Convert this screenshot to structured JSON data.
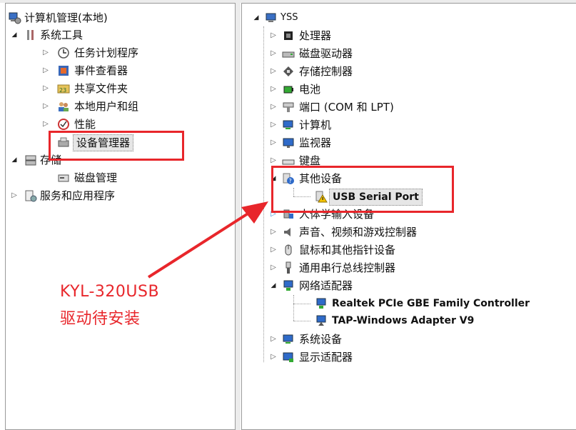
{
  "left_tree": {
    "root": "计算机管理(本地)",
    "system_tools": "系统工具",
    "task_scheduler": "任务计划程序",
    "event_viewer": "事件查看器",
    "shared_folders": "共享文件夹",
    "local_users": "本地用户和组",
    "performance": "性能",
    "device_manager": "设备管理器",
    "storage": "存储",
    "disk_management": "磁盘管理",
    "services_apps": "服务和应用程序"
  },
  "right_tree": {
    "root": "YSS",
    "processors": "处理器",
    "disk_drives": "磁盘驱动器",
    "storage_controllers": "存储控制器",
    "battery": "电池",
    "ports": "端口 (COM 和 LPT)",
    "computer": "计算机",
    "monitors": "监视器",
    "keyboards": "键盘",
    "other_devices": "其他设备",
    "usb_serial_port": "USB Serial Port",
    "hid": "人体学输入设备",
    "sound": "声音、视频和游戏控制器",
    "mice": "鼠标和其他指针设备",
    "usb_controllers": "通用串行总线控制器",
    "network_adapters": "网络适配器",
    "realtek": "Realtek PCIe GBE Family Controller",
    "tap": "TAP-Windows Adapter V9",
    "system_devices": "系统设备",
    "display_adapters": "显示适配器"
  },
  "annotation": {
    "line1": "KYL-320USB",
    "line2": "驱动待安装"
  },
  "colors": {
    "highlight_red": "#e8262b",
    "warning_yellow": "#f5c400"
  }
}
